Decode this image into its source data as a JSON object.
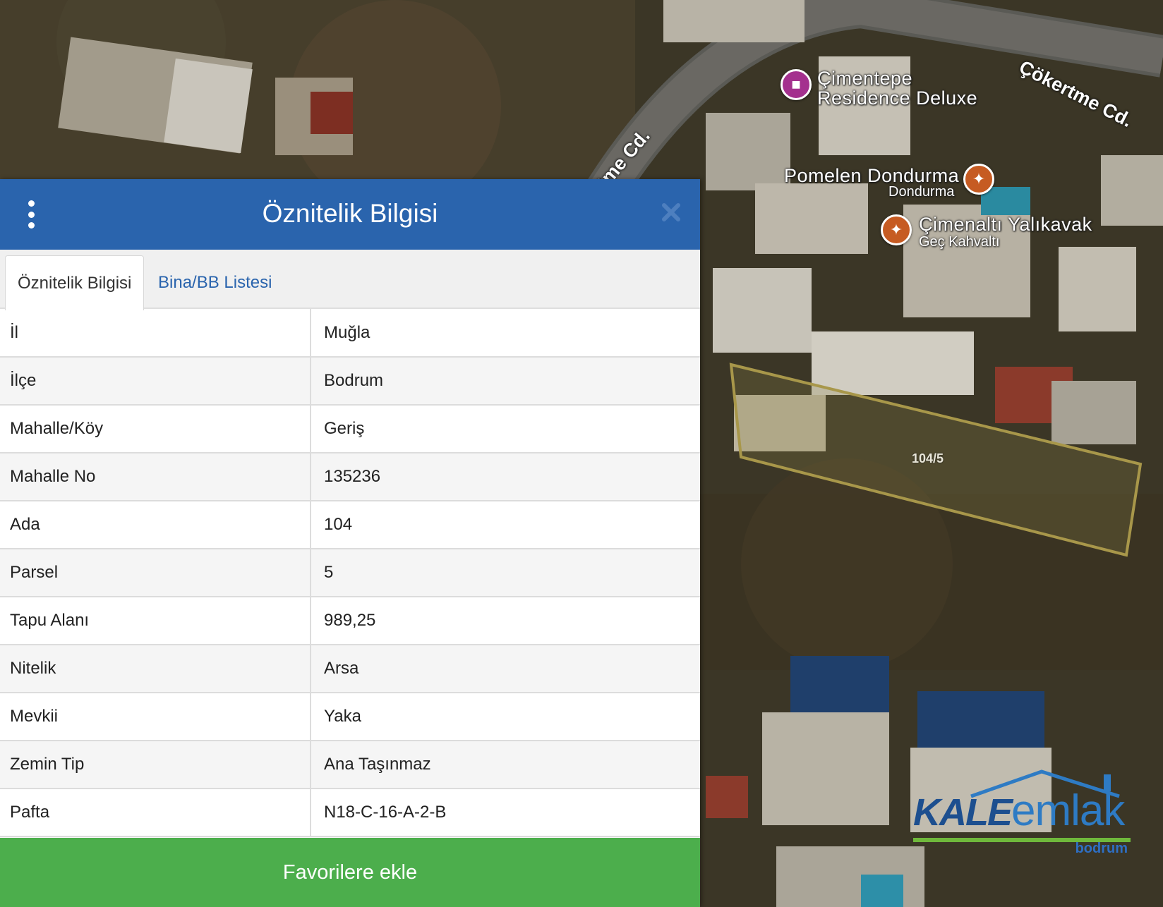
{
  "panel": {
    "title": "Öznitelik Bilgisi",
    "menu_icon": "vertical-dots-icon",
    "close_icon": "close-icon",
    "tabs": [
      {
        "label": "Öznitelik Bilgisi",
        "active": true
      },
      {
        "label": "Bina/BB Listesi",
        "active": false
      }
    ],
    "rows": [
      {
        "key": "İl",
        "value": "Muğla"
      },
      {
        "key": "İlçe",
        "value": "Bodrum"
      },
      {
        "key": "Mahalle/Köy",
        "value": "Geriş"
      },
      {
        "key": "Mahalle No",
        "value": "135236"
      },
      {
        "key": "Ada",
        "value": "104"
      },
      {
        "key": "Parsel",
        "value": "5"
      },
      {
        "key": "Tapu Alanı",
        "value": "989,25"
      },
      {
        "key": "Nitelik",
        "value": "Arsa"
      },
      {
        "key": "Mevkii",
        "value": "Yaka"
      },
      {
        "key": "Zemin Tip",
        "value": "Ana Taşınmaz"
      },
      {
        "key": "Pafta",
        "value": "N18-C-16-A-2-B"
      }
    ],
    "favorite_button": "Favorilere ekle"
  },
  "map": {
    "poi": [
      {
        "name": "Çimentepe",
        "name2": "Residence Deluxe",
        "icon": "hotel-icon"
      },
      {
        "name": "Pomelen Dondurma",
        "sub": "Dondurma",
        "icon": "restaurant-icon"
      },
      {
        "name": "Çimenaltı Yalıkavak",
        "sub": "Geç Kahvaltı",
        "icon": "restaurant-icon"
      }
    ],
    "roads": [
      "Çökertme Cd.",
      "tme Cd."
    ],
    "parcel_label": "104/5",
    "colors": {
      "parcel_outline": "#a8974a",
      "header_blue": "#2a64ad",
      "button_green": "#4cae4c"
    }
  },
  "logo": {
    "kale": "KALE",
    "emlak": "emlak",
    "sub": "bodrum"
  }
}
